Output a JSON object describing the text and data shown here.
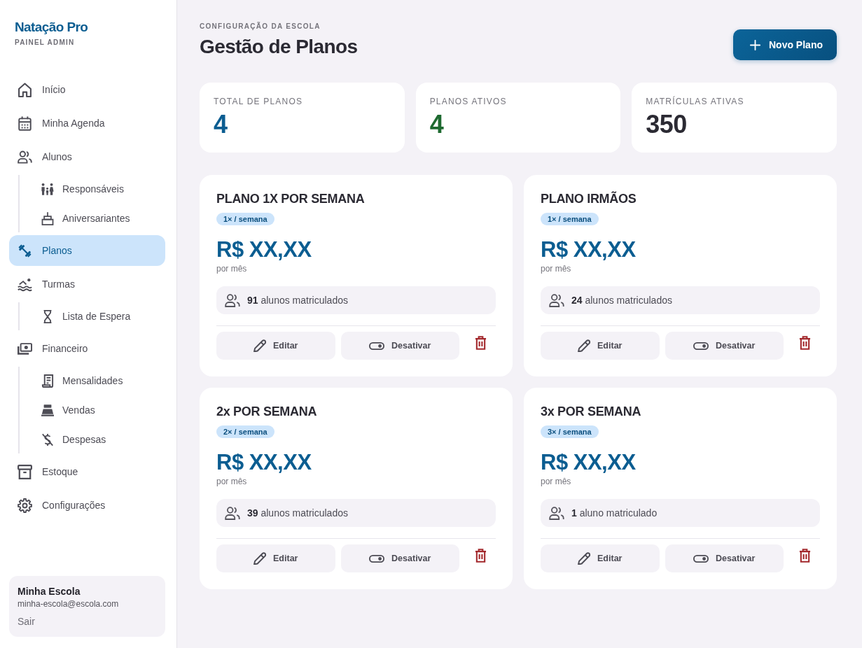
{
  "sidebar": {
    "brand": "Natação Pro",
    "subtitle": "PAINEL ADMIN",
    "items": [
      {
        "label": "Início",
        "selected": false
      },
      {
        "label": "Minha Agenda",
        "selected": false
      },
      {
        "label": "Alunos",
        "selected": false,
        "children": [
          {
            "label": "Responsáveis",
            "selected": false
          },
          {
            "label": "Aniversariantes",
            "selected": false
          }
        ]
      },
      {
        "label": "Planos",
        "selected": true
      },
      {
        "label": "Turmas",
        "selected": false,
        "children": [
          {
            "label": "Lista de Espera",
            "selected": false
          }
        ]
      },
      {
        "label": "Financeiro",
        "selected": false,
        "children": [
          {
            "label": "Mensalidades",
            "selected": false
          },
          {
            "label": "Vendas",
            "selected": false
          },
          {
            "label": "Despesas",
            "selected": false
          }
        ]
      },
      {
        "label": "Estoque",
        "selected": false
      },
      {
        "label": "Configurações",
        "selected": false
      }
    ],
    "account": {
      "name": "Minha Escola",
      "email": "minha-escola@escola.com",
      "logout": "Sair"
    }
  },
  "header": {
    "eyebrow": "CONFIGURAÇÃO DA ESCOLA",
    "title": "Gestão de Planos",
    "new_plan_button": "Novo Plano"
  },
  "stats": [
    {
      "label": "TOTAL DE PLANOS",
      "value": "4",
      "color": "#0b5d91"
    },
    {
      "label": "PLANOS ATIVOS",
      "value": "4",
      "color": "#1e6a30"
    },
    {
      "label": "MATRÍCULAS ATIVAS",
      "value": "350",
      "color": "#2b2a33"
    }
  ],
  "plans": [
    {
      "title": "PLANO 1X POR SEMANA",
      "frequency": "1× / semana",
      "price": "R$ XX,XX",
      "period": "por mês",
      "enrollment": "**91** alunos matriculados",
      "edit_button": "Editar",
      "toggle_button": "Desativar"
    },
    {
      "title": "PLANO IRMÃOS",
      "frequency": "1× / semana",
      "price": "R$ XX,XX",
      "period": "por mês",
      "enrollment": "**24** alunos matriculados",
      "edit_button": "Editar",
      "toggle_button": "Desativar"
    },
    {
      "title": "2x POR SEMANA",
      "frequency": "2× / semana",
      "price": "R$ XX,XX",
      "period": "por mês",
      "enrollment": "**39** alunos matriculados",
      "edit_button": "Editar",
      "toggle_button": "Desativar"
    },
    {
      "title": "3x POR SEMANA",
      "frequency": "3× / semana",
      "price": "R$ XX,XX",
      "period": "por mês",
      "enrollment": "**1** aluno matriculado",
      "edit_button": "Editar",
      "toggle_button": "Desativar"
    }
  ]
}
